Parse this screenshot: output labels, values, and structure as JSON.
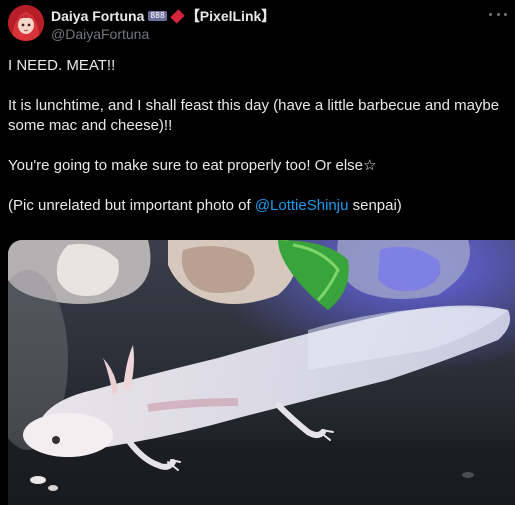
{
  "author": {
    "display_name": "Daiya Fortuna",
    "badge_text": "888",
    "org_tag": "【PixelLink】",
    "handle": "@DaiyaFortuna",
    "avatar_icon": "avatar-image",
    "diamond_color": "#d3263b"
  },
  "post": {
    "line1": "I NEED. MEAT!!",
    "line2": "It is lunchtime, and I shall feast this day (have a little barbecue and maybe some mac and cheese)!!",
    "line3": "You're going to make sure to eat properly too! Or else☆",
    "line4_prefix": "(Pic unrelated but important photo of ",
    "line4_mention": "@LottieShinju",
    "line4_suffix": " senpai)"
  },
  "colors": {
    "background": "#000000",
    "text": "#e7e9ea",
    "muted": "#71767b",
    "link": "#1d9bf0"
  },
  "icons": {
    "more": "more-dots-icon"
  }
}
